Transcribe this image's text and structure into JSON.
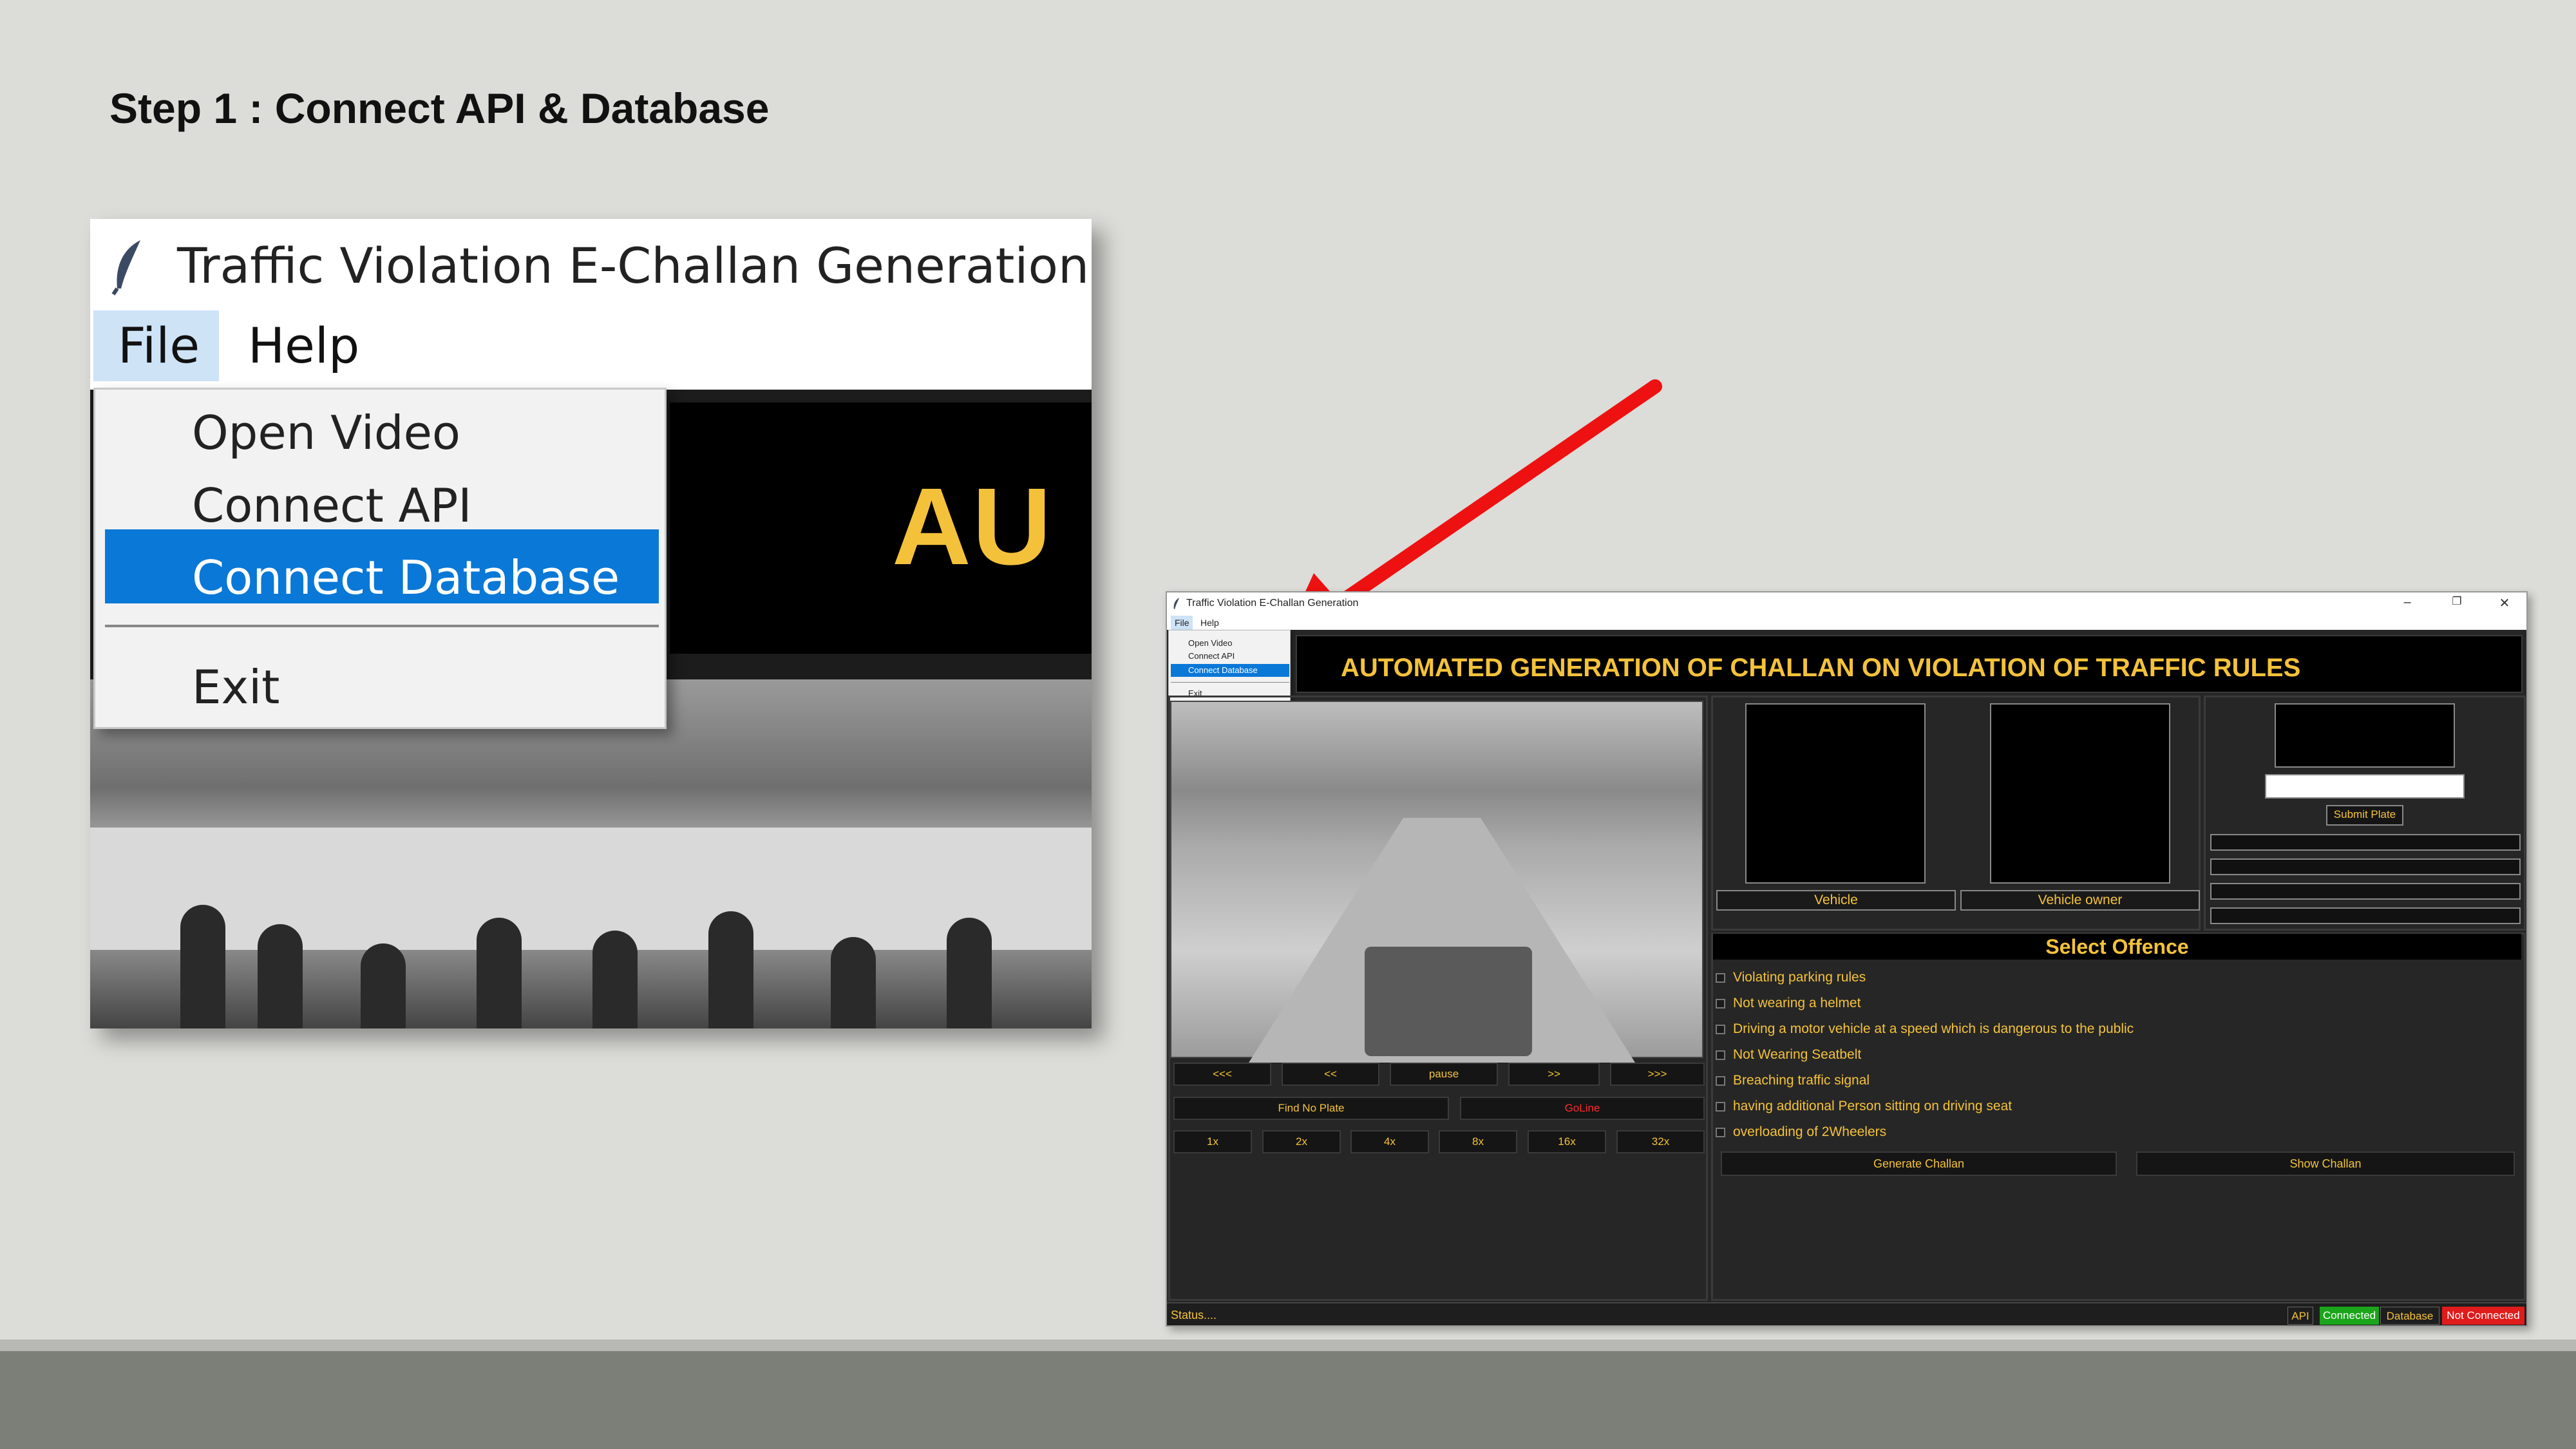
{
  "slide": {
    "title": "Step 1 : Connect API & Database"
  },
  "zoom": {
    "window_title": "Traffic Violation E-Challan Generation",
    "menu": {
      "file": "File",
      "help": "Help"
    },
    "dropdown": [
      "Open Video",
      "Connect API",
      "Connect Database",
      "Exit"
    ],
    "selected_item": "Connect Database",
    "banner_fragment": "AU"
  },
  "app": {
    "window_title": "Traffic Violation E-Challan Generation",
    "window_controls": {
      "minimize": "–",
      "restore": "❐",
      "close": "✕"
    },
    "menu": {
      "file": "File",
      "help": "Help"
    },
    "dropdown": [
      "Open Video",
      "Connect API",
      "Connect Database",
      "Exit"
    ],
    "header_title": "AUTOMATED GENERATION OF CHALLAN ON VIOLATION OF TRAFFIC RULES",
    "playback_buttons": [
      "<<<",
      "<<",
      "pause",
      ">>",
      ">>>"
    ],
    "find_plate_label": "Find No Plate",
    "goline_label": "GoLine",
    "speed_buttons": [
      "1x",
      "2x",
      "4x",
      "8x",
      "16x",
      "32x"
    ],
    "vehicle_label": "Vehicle",
    "vehicle_owner_label": "Vehicle owner",
    "submit_plate_label": "Submit Plate",
    "offence_header": "Select Offence",
    "offences": [
      "Violating parking rules",
      "Not wearing a helmet",
      "Driving a motor vehicle at a speed which is dangerous to the public",
      "Not Wearing Seatbelt",
      "Breaching traffic signal",
      "having additional Person sitting on driving seat",
      "overloading of 2Wheelers"
    ],
    "generate_challan_label": "Generate Challan",
    "show_challan_label": "Show Challan",
    "status_text": "Status....",
    "api_label": "API",
    "api_status": "Connected",
    "database_label": "Database",
    "database_status": "Not Connected",
    "colors": {
      "accent": "#f4c23a",
      "connected": "#1aa51a",
      "not_connected": "#e01b1b",
      "selection": "#0a78d7"
    }
  }
}
